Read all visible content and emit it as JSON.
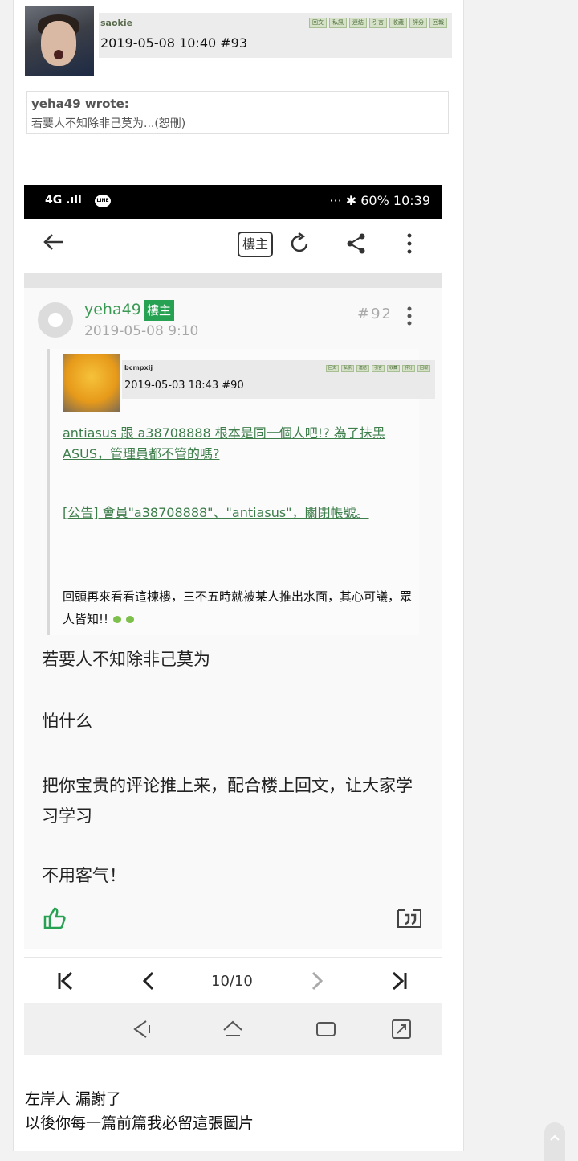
{
  "top_post": {
    "username": "saokie",
    "datetime_floor": "2019-05-08 10:40  #93",
    "action_buttons": [
      "回文",
      "私訊",
      "連結",
      "引言",
      "收藏",
      "評分",
      "回報"
    ],
    "quote": {
      "author": "yeha49 wrote:",
      "text": "若要人不知除非己莫为...(恕刪)"
    }
  },
  "embedded_screenshot": {
    "status_bar": {
      "network": "4G",
      "line_app": "LINE",
      "right": "··· ✱ 60% 10:39"
    },
    "app_bar": {
      "louzhu_button": "樓主"
    },
    "post": {
      "username": "yeha49",
      "badge": "樓主",
      "datetime": "2019-05-08 9:10",
      "floor": "#92",
      "inner_quote": {
        "username": "bcmpxij",
        "datetime_floor": "2019-05-03 18:43  #90",
        "action_buttons": [
          "回文",
          "私訊",
          "連結",
          "引言",
          "收藏",
          "評分",
          "回報"
        ],
        "link1": "antiasus 跟 a38708888 根本是同一個人吧!? 為了抹黑ASUS，管理員都不管的嗎?",
        "link2": "[公告] 會員\"a38708888\"、\"antiasus\"，關閉帳號。",
        "text": "回頭再來看看這棟樓，三不五時就被某人推出水面，其心可議，眾人皆知!!"
      },
      "paragraphs": [
        "若要人不知除非己莫为",
        "怕什么",
        "把你宝贵的评论推上来，配合楼上回文，让大家学习学习",
        "不用客气！"
      ]
    },
    "pager": {
      "text": "10/10"
    }
  },
  "footer": {
    "line1": "左岸人 漏謝了",
    "line2": "以後你每一篇前篇我必留這張圖片"
  },
  "colors": {
    "green": "#3a9a54",
    "badge_green": "#27a152",
    "link_green": "#3d7e4b"
  }
}
